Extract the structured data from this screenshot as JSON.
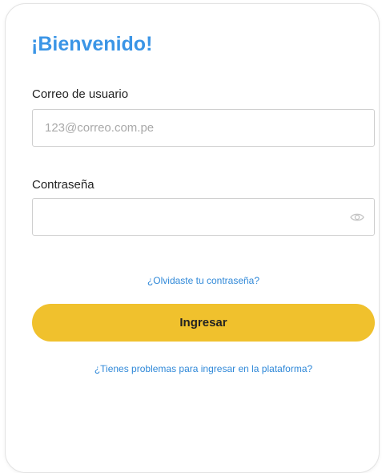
{
  "login": {
    "title": "¡Bienvenido!",
    "email": {
      "label": "Correo de usuario",
      "placeholder": "123@correo.com.pe",
      "value": ""
    },
    "password": {
      "label": "Contraseña",
      "placeholder": "",
      "value": "",
      "toggle_icon": "eye-icon"
    },
    "forgot_link": "¿Olvidaste tu contraseña?",
    "submit_label": "Ingresar",
    "help_link": "¿Tienes problemas para ingresar en la plataforma?"
  },
  "colors": {
    "title": "#3b95e6",
    "link": "#2f88d8",
    "button": "#f0c12d",
    "field_border": "#cfcfcf"
  }
}
